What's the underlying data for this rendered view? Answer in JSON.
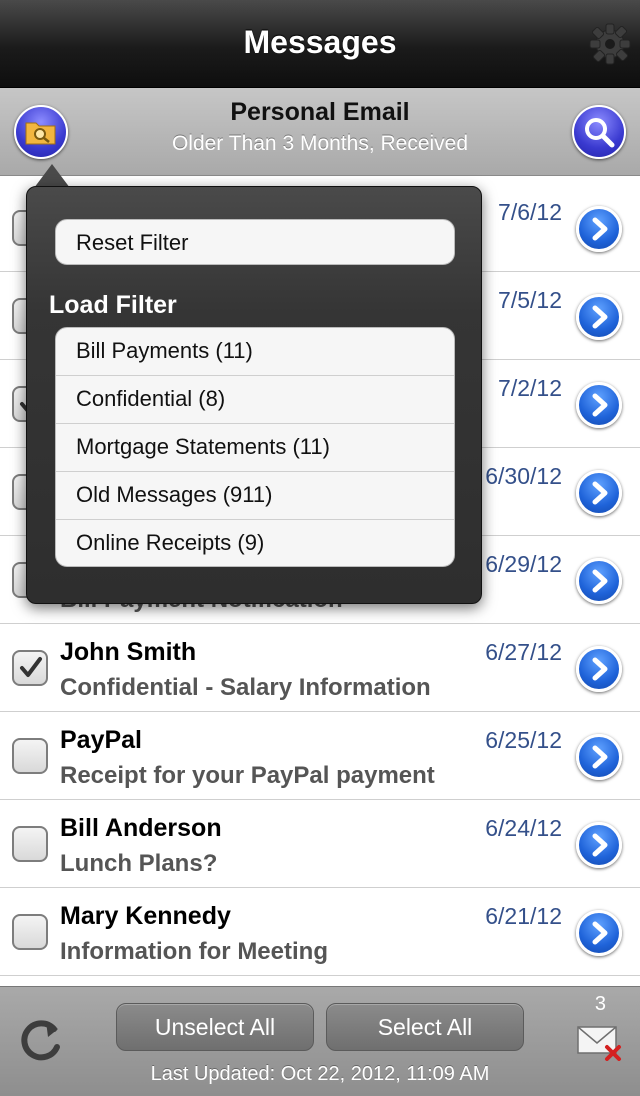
{
  "header": {
    "title": "Messages"
  },
  "filter": {
    "name": "Personal Email",
    "description": "Older Than 3 Months, Received"
  },
  "messages": [
    {
      "sender": "",
      "subject": "",
      "date": "7/6/12",
      "checked": false
    },
    {
      "sender": "",
      "subject": "",
      "date": "7/5/12",
      "checked": false
    },
    {
      "sender": "",
      "subject": "",
      "date": "7/2/12",
      "checked": true
    },
    {
      "sender": "",
      "subject": "",
      "date": "6/30/12",
      "checked": false
    },
    {
      "sender": "",
      "subject": "Bill Payment Notification",
      "date": "6/29/12",
      "checked": false
    },
    {
      "sender": "John Smith",
      "subject": "Confidential - Salary Information",
      "date": "6/27/12",
      "checked": true
    },
    {
      "sender": "PayPal",
      "subject": "Receipt for your PayPal payment",
      "date": "6/25/12",
      "checked": false
    },
    {
      "sender": "Bill Anderson",
      "subject": "Lunch Plans?",
      "date": "6/24/12",
      "checked": false
    },
    {
      "sender": "Mary Kennedy",
      "subject": "Information for Meeting",
      "date": "6/21/12",
      "checked": false
    }
  ],
  "popover": {
    "reset_label": "Reset Filter",
    "load_label": "Load Filter",
    "filters": [
      "Bill Payments (11)",
      "Confidential (8)",
      "Mortgage Statements (11)",
      "Old Messages (911)",
      "Online Receipts (9)"
    ]
  },
  "footer": {
    "unselect_label": "Unselect All",
    "select_label": "Select All",
    "last_updated": "Last Updated: Oct 22, 2012, 11:09 AM",
    "mail_count": "3"
  },
  "colors": {
    "date_text": "#34508a",
    "accent_blue": "#1f63d9",
    "search_button": "#3a3ad0"
  },
  "icons": [
    "gear-icon",
    "folder-search-icon",
    "search-icon",
    "checkmark-icon",
    "chevron-right-icon",
    "refresh-icon",
    "mail-delete-icon"
  ]
}
